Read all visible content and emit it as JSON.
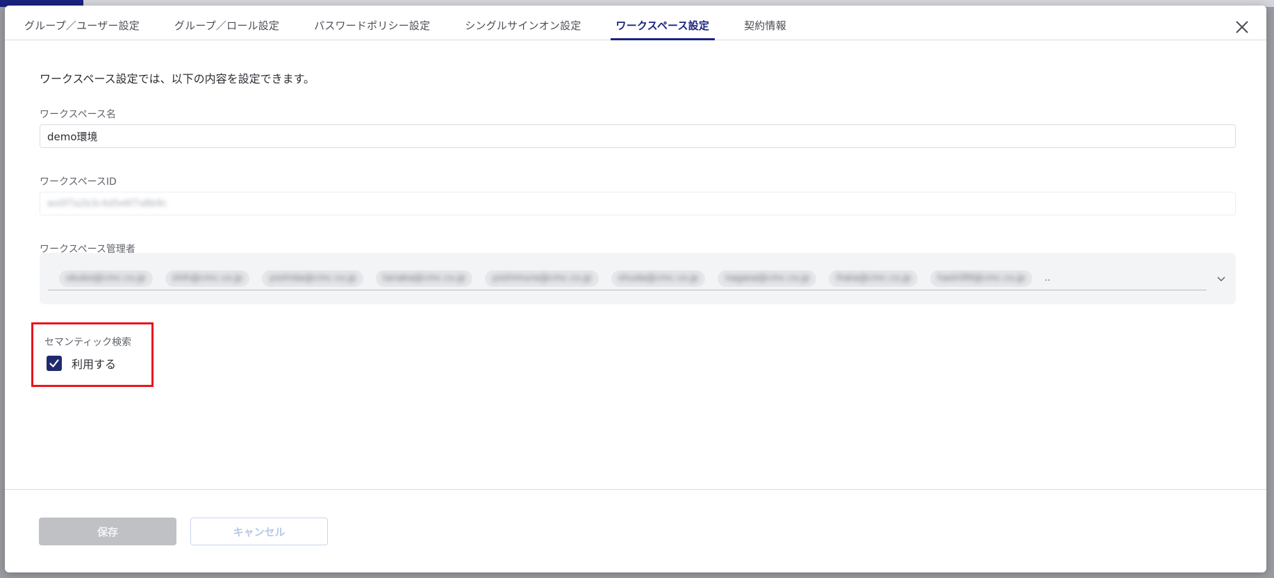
{
  "tabs": [
    {
      "label": "グループ／ユーザー設定",
      "active": false
    },
    {
      "label": "グループ／ロール設定",
      "active": false
    },
    {
      "label": "パスワードポリシー設定",
      "active": false
    },
    {
      "label": "シングルサインオン設定",
      "active": false
    },
    {
      "label": "ワークスペース設定",
      "active": true
    },
    {
      "label": "契約情報",
      "active": false
    }
  ],
  "intro": "ワークスペース設定では、以下の内容を設定できます。",
  "workspace_name": {
    "label": "ワークスペース名",
    "value": "demo環境"
  },
  "workspace_id": {
    "label": "ワークスペースID",
    "value": "ws0f7a2b3c4d5e6f7a8b9c"
  },
  "workspace_admins": {
    "label": "ワークスペース管理者",
    "values": [
      "okubo@cmc.co.jp",
      "shih@cmc.co.jp",
      "yoshida@cmc.co.jp",
      "tanaka@cmc.co.jp",
      "yoshimura@cmc.co.jp",
      "ohuda@cmc.co.jp",
      "nagasa@cmc.co.jp",
      "ihata@cmc.co.jp",
      "hashi99@cmc.co.jp"
    ],
    "more": "‥"
  },
  "semantic_search": {
    "label": "セマンティック検索",
    "option": "利用する",
    "checked": true
  },
  "footer": {
    "save": "保存",
    "cancel": "キャンセル"
  },
  "colors": {
    "accent": "#1a237e",
    "highlight": "#e8141c"
  }
}
